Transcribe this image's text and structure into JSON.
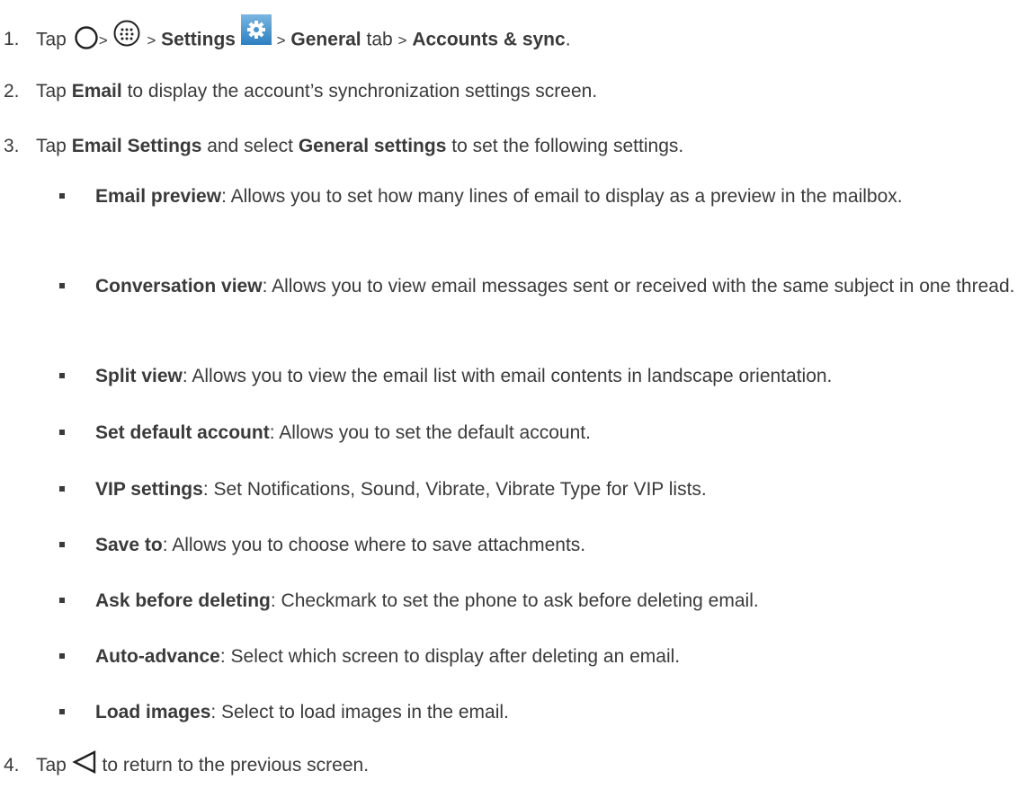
{
  "steps": [
    {
      "num": "1.",
      "parts": {
        "tap": "Tap",
        "sep": ">",
        "settings": "Settings",
        "general": "General",
        "tab": "tab",
        "accounts": "Accounts & sync",
        "end": "."
      },
      "icons": [
        "home-circle-icon",
        "apps-grid-icon",
        "settings-gear-icon"
      ]
    },
    {
      "num": "2.",
      "parts": {
        "tap": "Tap",
        "email": "Email",
        "rest": "to display the account’s synchronization settings screen."
      }
    },
    {
      "num": "3.",
      "parts": {
        "tap": "Tap",
        "email_settings": "Email Settings",
        "and_select": "and select",
        "general_settings": "General settings",
        "rest": "to set the following settings."
      }
    },
    {
      "num": "4.",
      "parts": {
        "tap": "Tap",
        "rest": "to return to the previous screen."
      },
      "icons": [
        "back-triangle-icon"
      ]
    }
  ],
  "bullets": [
    {
      "term": "Email preview",
      "desc": ": Allows you to set how many lines of email to display as a preview in the mailbox."
    },
    {
      "term": "Conversation view",
      "desc": ": Allows you to view email messages sent or received with the same subject in one thread."
    },
    {
      "term": "Split view",
      "desc": ": Allows you to view the email list with email contents in landscape orientation."
    },
    {
      "term": "Set default account",
      "desc": ": Allows you to set the default account."
    },
    {
      "term": "VIP settings",
      "desc": ": Set Notifications, Sound, Vibrate, Vibrate Type for VIP lists."
    },
    {
      "term": "Save to",
      "desc": ": Allows you to choose where to save attachments."
    },
    {
      "term": "Ask before deleting",
      "desc": ": Checkmark to set the phone to ask before deleting email."
    },
    {
      "term": "Auto-advance",
      "desc": ": Select which screen to display after deleting an email."
    },
    {
      "term": "Load images",
      "desc": ": Select to load images in the email."
    }
  ],
  "colors": {
    "text": "#3a3a3a",
    "gear_top": "#7ab6e0",
    "gear_bottom": "#2d7fc1"
  }
}
